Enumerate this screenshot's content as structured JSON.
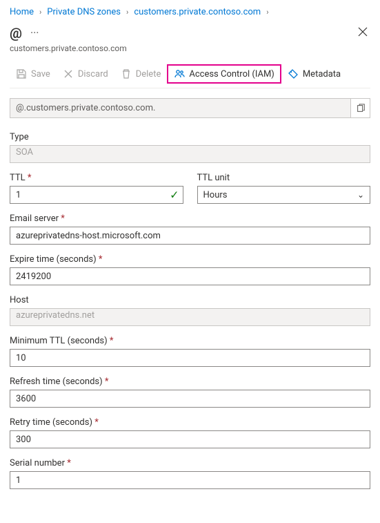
{
  "breadcrumb": {
    "home": "Home",
    "zones": "Private DNS zones",
    "zone": "customers.private.contoso.com"
  },
  "header": {
    "title": "@",
    "subtitle": "customers.private.contoso.com"
  },
  "toolbar": {
    "save": "Save",
    "discard": "Discard",
    "delete": "Delete",
    "iam": "Access Control (IAM)",
    "metadata": "Metadata"
  },
  "fqdn": "@.customers.private.contoso.com.",
  "fields": {
    "type_label": "Type",
    "type_value": "SOA",
    "ttl_label": "TTL",
    "ttl_value": "1",
    "ttl_unit_label": "TTL unit",
    "ttl_unit_value": "Hours",
    "email_label": "Email server",
    "email_value": "azureprivatedns-host.microsoft.com",
    "expire_label": "Expire time (seconds)",
    "expire_value": "2419200",
    "host_label": "Host",
    "host_value": "azureprivatedns.net",
    "minttl_label": "Minimum TTL (seconds)",
    "minttl_value": "10",
    "refresh_label": "Refresh time (seconds)",
    "refresh_value": "3600",
    "retry_label": "Retry time (seconds)",
    "retry_value": "300",
    "serial_label": "Serial number",
    "serial_value": "1"
  }
}
